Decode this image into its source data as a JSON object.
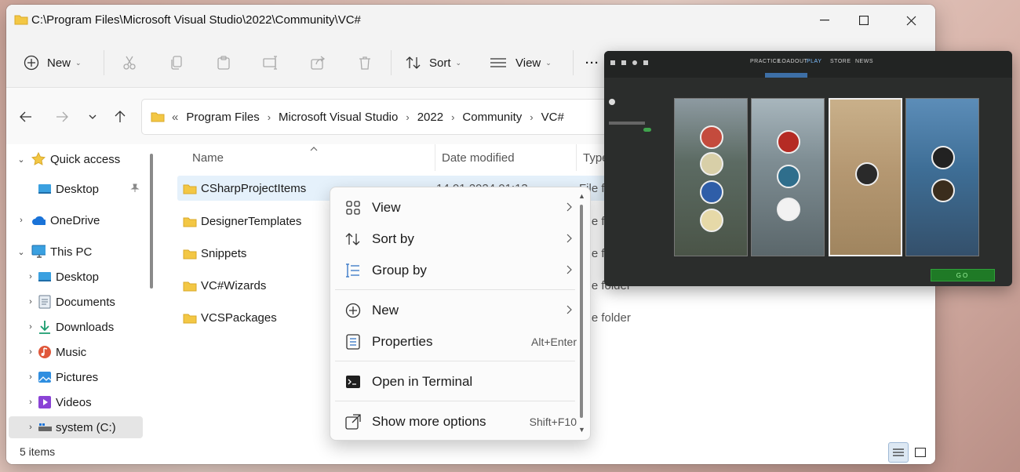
{
  "window": {
    "title": "C:\\Program Files\\Microsoft Visual Studio\\2022\\Community\\VC#"
  },
  "toolbar": {
    "new_label": "New",
    "sort_label": "Sort",
    "view_label": "View",
    "more_label": "···"
  },
  "address": {
    "overflow": "«",
    "crumbs": [
      "Program Files",
      "Microsoft Visual Studio",
      "2022",
      "Community",
      "VC#"
    ]
  },
  "sidebar": {
    "items": [
      {
        "label": "Quick access",
        "icon": "star-icon"
      },
      {
        "label": "Desktop",
        "icon": "desktop-icon"
      },
      {
        "label": "OneDrive",
        "icon": "cloud-icon"
      },
      {
        "label": "This PC",
        "icon": "monitor-icon"
      },
      {
        "label": "Desktop",
        "icon": "desktop-icon"
      },
      {
        "label": "Documents",
        "icon": "documents-icon"
      },
      {
        "label": "Downloads",
        "icon": "download-icon"
      },
      {
        "label": "Music",
        "icon": "music-icon"
      },
      {
        "label": "Pictures",
        "icon": "pictures-icon"
      },
      {
        "label": "Videos",
        "icon": "videos-icon"
      },
      {
        "label": "system (C:)",
        "icon": "drive-icon"
      }
    ]
  },
  "columns": {
    "name": "Name",
    "date": "Date modified",
    "type": "Type"
  },
  "files": [
    {
      "name": "CSharpProjectItems",
      "date": "14.01.2024 01:13",
      "type": "File folder"
    },
    {
      "name": "DesignerTemplates",
      "date": "",
      "type": "File folder"
    },
    {
      "name": "Snippets",
      "date": "",
      "type": "File folder"
    },
    {
      "name": "VC#Wizards",
      "date": "",
      "type": "File folder"
    },
    {
      "name": "VCSPackages",
      "date": "",
      "type": "File folder"
    }
  ],
  "status": {
    "item_count": "5 items"
  },
  "context_menu": {
    "view": "View",
    "sort_by": "Sort by",
    "group_by": "Group by",
    "new": "New",
    "properties": "Properties",
    "properties_shortcut": "Alt+Enter",
    "open_terminal": "Open in Terminal",
    "more_options": "Show more options",
    "more_options_shortcut": "Shift+F10"
  },
  "game_overlay": {
    "nav": [
      "PRACTICE",
      "LOADOUT",
      "PLAY",
      "STORE",
      "NEWS"
    ],
    "go": "GO",
    "maps": [
      "",
      "",
      "",
      ""
    ]
  },
  "colors": {
    "accent": "#0067c0",
    "folder": "#f3c744",
    "selection": "#e5f1fb",
    "go_green": "#1f7a26"
  }
}
